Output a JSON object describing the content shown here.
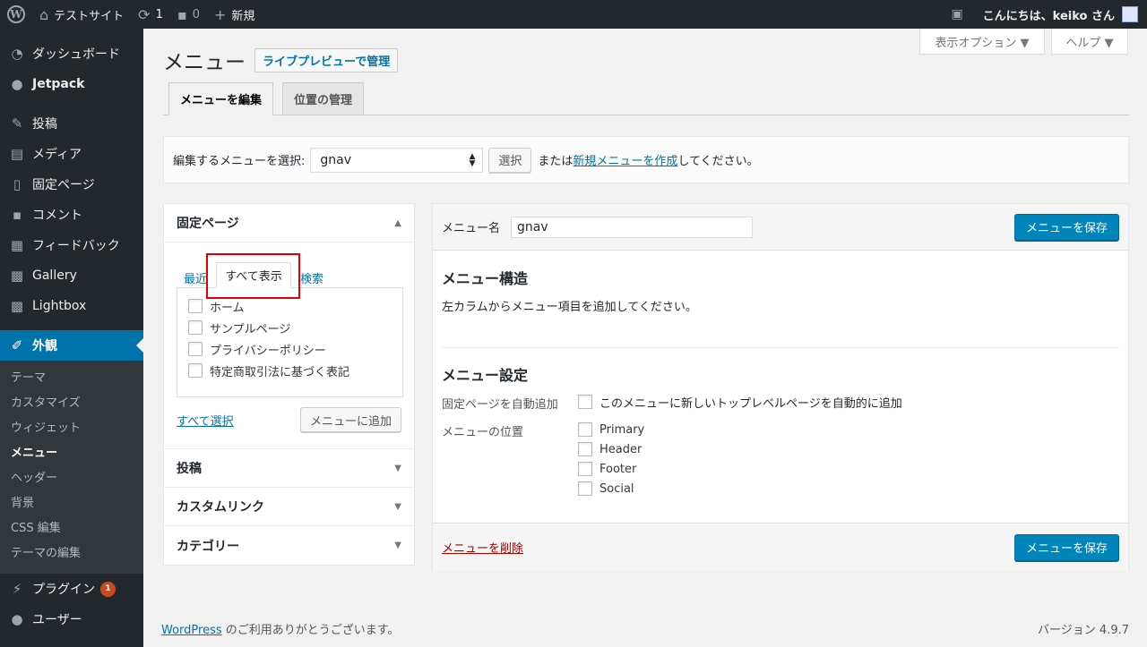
{
  "adminbar": {
    "site_name": "テストサイト",
    "updates_count": "1",
    "comments_count": "0",
    "new_label": "新規",
    "greeting": "こんにちは、keiko さん"
  },
  "sidebar": {
    "items": [
      {
        "label": "ダッシュボード",
        "icon": "dashboard-icon"
      },
      {
        "label": "Jetpack",
        "icon": "jetpack-icon"
      },
      {
        "label": "投稿",
        "icon": "pin-icon"
      },
      {
        "label": "メディア",
        "icon": "media-icon"
      },
      {
        "label": "固定ページ",
        "icon": "page-icon"
      },
      {
        "label": "コメント",
        "icon": "comment-icon"
      },
      {
        "label": "フィードバック",
        "icon": "feedback-icon"
      },
      {
        "label": "Gallery",
        "icon": "gallery-icon"
      },
      {
        "label": "Lightbox",
        "icon": "lightbox-icon"
      },
      {
        "label": "外観",
        "icon": "appearance-icon"
      },
      {
        "label": "プラグイン",
        "icon": "plugin-icon",
        "badge": "1"
      },
      {
        "label": "ユーザー",
        "icon": "user-icon"
      }
    ],
    "appearance_sub": [
      "テーマ",
      "カスタマイズ",
      "ウィジェット",
      "メニュー",
      "ヘッダー",
      "背景",
      "CSS 編集",
      "テーマの編集"
    ]
  },
  "screen_meta": {
    "options_label": "表示オプション ▼",
    "help_label": "ヘルプ ▼"
  },
  "page": {
    "title": "メニュー",
    "live_preview_label": "ライブプレビューで管理",
    "tabs": [
      "メニューを編集",
      "位置の管理"
    ]
  },
  "manage": {
    "prefix": "編集するメニューを選択:",
    "selected_menu": "gnav",
    "select_button": "選択",
    "or_text": "または",
    "create_link": "新規メニューを作成",
    "suffix": "してください。"
  },
  "accordion": {
    "pages_title": "固定ページ",
    "tab_recent": "最近",
    "tab_all": "すべて表示",
    "tab_search": "検索",
    "pages": [
      "ホーム",
      "サンプルページ",
      "プライバシーポリシー",
      "特定商取引法に基づく表記"
    ],
    "select_all": "すべて選択",
    "add_to_menu": "メニューに追加",
    "sections": [
      "投稿",
      "カスタムリンク",
      "カテゴリー"
    ]
  },
  "menu_edit": {
    "name_label": "メニュー名",
    "name_value": "gnav",
    "save_label": "メニューを保存",
    "structure_title": "メニュー構造",
    "structure_desc": "左カラムからメニュー項目を追加してください。",
    "settings_title": "メニュー設定",
    "auto_add_label": "固定ページを自動追加",
    "auto_add_option": "このメニューに新しいトップレベルページを自動的に追加",
    "locations_label": "メニューの位置",
    "locations": [
      "Primary",
      "Header",
      "Footer",
      "Social"
    ],
    "delete_label": "メニューを削除"
  },
  "footer": {
    "wp_link": "WordPress",
    "thanks": " のご利用ありがとうございます。",
    "version": "バージョン 4.9.7"
  }
}
